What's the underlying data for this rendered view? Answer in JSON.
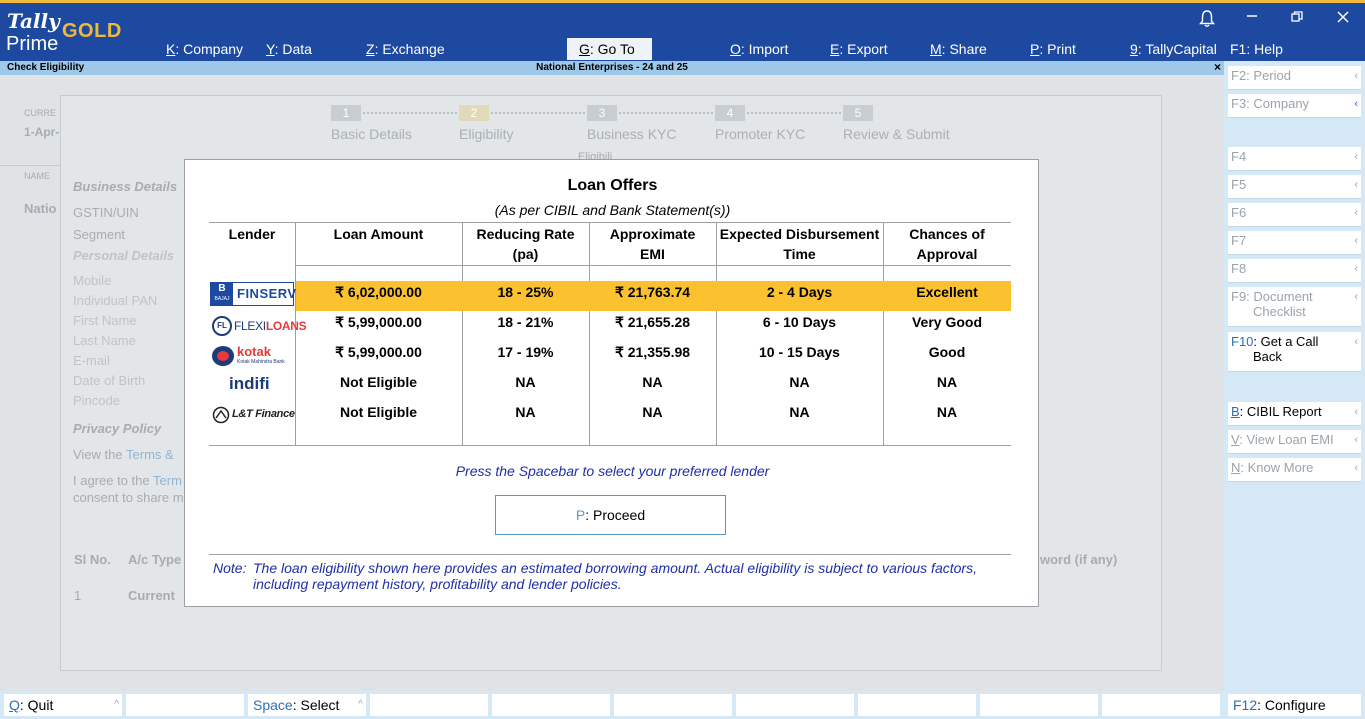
{
  "app": {
    "brand_tally": "Tally",
    "brand_prime": "Prime",
    "brand_edition": "GOLD"
  },
  "menu": [
    {
      "key": "K",
      "label": "Company"
    },
    {
      "key": "Y",
      "label": "Data"
    },
    {
      "key": "Z",
      "label": "Exchange"
    },
    {
      "key": "G",
      "label": "Go To"
    },
    {
      "key": "O",
      "label": "Import"
    },
    {
      "key": "E",
      "label": "Export"
    },
    {
      "key": "M",
      "label": "Share"
    },
    {
      "key": "P",
      "label": "Print"
    },
    {
      "key": "9",
      "label": "TallyCapital"
    },
    {
      "key": "F1",
      "label": "Help"
    }
  ],
  "titlebar": {
    "left": "Check Eligibility",
    "center": "National Enterprises - 24 and 25",
    "close": "×"
  },
  "right_panel": [
    {
      "key": "F2",
      "label": "Period"
    },
    {
      "key": "F3",
      "label": "Company"
    },
    {
      "key": "F4",
      "label": ""
    },
    {
      "key": "F5",
      "label": ""
    },
    {
      "key": "F6",
      "label": ""
    },
    {
      "key": "F7",
      "label": ""
    },
    {
      "key": "F8",
      "label": ""
    },
    {
      "key": "F9",
      "label": "Document",
      "label2": "Checklist"
    },
    {
      "key": "F10",
      "label": "Get a Call",
      "label2": "Back"
    },
    {
      "key": "B",
      "label": "CIBIL Report"
    },
    {
      "key": "V",
      "label": "View Loan EMI"
    },
    {
      "key": "N",
      "label": "Know More"
    }
  ],
  "bottom_bar": [
    {
      "key": "Q",
      "label": "Quit"
    },
    {
      "key": "Space",
      "label": "Select"
    },
    {
      "key": "F12",
      "label": "Configure"
    }
  ],
  "background": {
    "curr_label": "CURRE",
    "curr_date": "1-Apr-",
    "name_label": "NAME",
    "name_value": "Natio",
    "steps": [
      {
        "num": "1",
        "label": "Basic Details"
      },
      {
        "num": "2",
        "label": "Eligibility"
      },
      {
        "num": "3",
        "label": "Business KYC"
      },
      {
        "num": "4",
        "label": "Promoter KYC"
      },
      {
        "num": "5",
        "label": "Review & Submit"
      }
    ],
    "elig_frag": "Eligibili",
    "business_details": "Business Details",
    "gstin": "GSTIN/UIN",
    "segment": "Segment",
    "personal_details": "Personal Details",
    "mobile": "Mobile",
    "pan": "Individual PAN",
    "first_name": "First Name",
    "last_name": "Last Name",
    "email": "E-mail",
    "dob": "Date of Birth",
    "pincode": "Pincode",
    "privacy": "Privacy Policy",
    "view_the": "View the",
    "terms": "Terms & ",
    "agree1": "I agree to the",
    "agree_terms": "Term",
    "agree2": "consent to share m",
    "sl_no": "Sl No.",
    "ac_type": "A/c Type",
    "pwd": "word (if any)",
    "row_no": "1",
    "row_type": "Current"
  },
  "modal": {
    "title": "Loan Offers",
    "subtitle": "(As per CIBIL and Bank Statement(s))",
    "headers": {
      "lender": "Lender",
      "amount": "Loan Amount",
      "rate_1": "Reducing Rate",
      "rate_2": "(pa)",
      "emi_1": "Approximate",
      "emi_2": "EMI",
      "time_1": "Expected Disbursement",
      "time_2": "Time",
      "chance_1": "Chances of",
      "chance_2": "Approval"
    },
    "rows": [
      {
        "lender": "Bajaj Finserv",
        "amount": "₹ 6,02,000.00",
        "rate": "18 - 25%",
        "emi": "₹ 21,763.74",
        "time": "2 - 4 Days",
        "chance": "Excellent"
      },
      {
        "lender": "FlexiLoans",
        "amount": "₹ 5,99,000.00",
        "rate": "18 - 21%",
        "emi": "₹ 21,655.28",
        "time": "6 - 10 Days",
        "chance": "Very Good"
      },
      {
        "lender": "Kotak",
        "amount": "₹ 5,99,000.00",
        "rate": "17 - 19%",
        "emi": "₹ 21,355.98",
        "time": "10 - 15 Days",
        "chance": "Good"
      },
      {
        "lender": "indifi",
        "amount": "Not Eligible",
        "rate": "NA",
        "emi": "NA",
        "time": "NA",
        "chance": "NA"
      },
      {
        "lender": "L&T Finance",
        "amount": "Not Eligible",
        "rate": "NA",
        "emi": "NA",
        "time": "NA",
        "chance": "NA"
      }
    ],
    "logos": {
      "bajaj_b": "B",
      "bajaj_sub": "BAJAJ",
      "bajaj_word": "FINSERV",
      "flexi_mark": "FL",
      "flexi_word": "FLEXI",
      "flexi_word2": "LOANS",
      "kotak_word": "kotak",
      "kotak_sub": "Kotak Mahindra Bank",
      "indifi_word": "indifi",
      "lt_word": "L&T Finance"
    },
    "press_hint": "Press the Spacebar to select your preferred lender",
    "proceed_key": "P",
    "proceed_label": "Proceed",
    "note_label": "Note:",
    "note_text": "The loan eligibility shown here provides an estimated borrowing amount. Actual eligibility is subject to various factors, including repayment history, profitability and lender policies."
  },
  "colors": {
    "header_blue": "#1d4aa0",
    "gold": "#f0b93a",
    "highlight": "#fcc12f",
    "hint_blue": "#1e2fa8"
  }
}
